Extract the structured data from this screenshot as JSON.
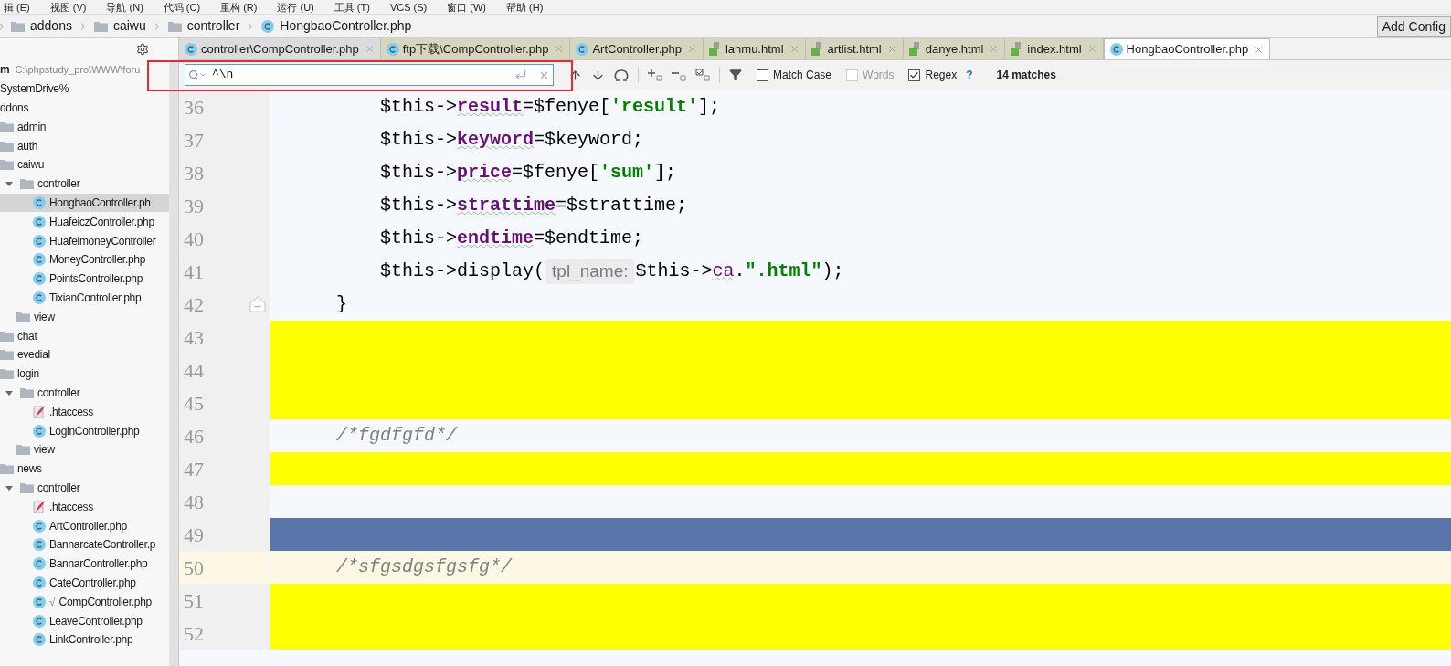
{
  "menu": [
    "辑 (E)",
    "视图 (V)",
    "导航 (N)",
    "代码 (C)",
    "重构 (R)",
    "运行 (U)",
    "工具 (T)",
    "VCS (S)",
    "窗口 (W)",
    "帮助 (H)"
  ],
  "breadcrumb": [
    {
      "label": "addons",
      "kind": "folder"
    },
    {
      "label": "caiwu",
      "kind": "folder"
    },
    {
      "label": "controller",
      "kind": "folder"
    },
    {
      "label": "HongbaoController.php",
      "kind": "php"
    }
  ],
  "run_config_button": "Add Config",
  "tree": [
    {
      "label": "m",
      "path": "C:\\phpstudy_pro\\WWW\\foru",
      "kind": "root",
      "selected": false
    },
    {
      "label": "SystemDrive%",
      "kind": "drive",
      "selected": false
    },
    {
      "label": "ddons",
      "kind": "folder",
      "selected": false,
      "children": [
        {
          "label": "admin",
          "kind": "folder",
          "selected": false
        },
        {
          "label": "auth",
          "kind": "folder",
          "selected": false
        },
        {
          "label": "caiwu",
          "kind": "folder",
          "selected": false,
          "children": [
            {
              "label": "controller",
              "kind": "folder",
              "expanded": true,
              "selected": false,
              "children": [
                {
                  "label": "HongbaoController.ph",
                  "kind": "php",
                  "selected": true
                },
                {
                  "label": "HuafeiczController.php",
                  "kind": "php",
                  "selected": false
                },
                {
                  "label": "HuafeimoneyController",
                  "kind": "php",
                  "selected": false
                },
                {
                  "label": "MoneyController.php",
                  "kind": "php",
                  "selected": false
                },
                {
                  "label": "PointsController.php",
                  "kind": "php",
                  "selected": false
                },
                {
                  "label": "TixianController.php",
                  "kind": "php",
                  "selected": false
                }
              ]
            },
            {
              "label": "view",
              "kind": "folder",
              "selected": false
            }
          ]
        },
        {
          "label": "chat",
          "kind": "folder",
          "selected": false
        },
        {
          "label": "evedial",
          "kind": "folder",
          "selected": false
        },
        {
          "label": "login",
          "kind": "folder",
          "selected": false,
          "children": [
            {
              "label": "controller",
              "kind": "folder",
              "expanded": true,
              "selected": false,
              "children": [
                {
                  "label": ".htaccess",
                  "kind": "htaccess",
                  "selected": false
                },
                {
                  "label": "LoginController.php",
                  "kind": "php",
                  "selected": false
                }
              ]
            },
            {
              "label": "view",
              "kind": "folder",
              "selected": false
            }
          ]
        },
        {
          "label": "news",
          "kind": "folder",
          "selected": false,
          "children": [
            {
              "label": "controller",
              "kind": "folder",
              "expanded": true,
              "selected": false,
              "children": [
                {
                  "label": ".htaccess",
                  "kind": "htaccess",
                  "selected": false
                },
                {
                  "label": "ArtController.php",
                  "kind": "php",
                  "selected": false
                },
                {
                  "label": "BannarcateController.p",
                  "kind": "php",
                  "selected": false
                },
                {
                  "label": "BannarController.php",
                  "kind": "php",
                  "selected": false
                },
                {
                  "label": "CateController.php",
                  "kind": "php",
                  "selected": false
                },
                {
                  "label": "CompController.php",
                  "prefix": "√",
                  "kind": "php",
                  "selected": false
                },
                {
                  "label": "LeaveController.php",
                  "kind": "php",
                  "selected": false
                },
                {
                  "label": "LinkController.php",
                  "kind": "php",
                  "selected": false
                }
              ]
            }
          ]
        }
      ]
    }
  ],
  "tabs": [
    {
      "label": "controller\\CompController.php",
      "kind": "php",
      "color": "#dcdcdc",
      "selected": false
    },
    {
      "label": "ftp下载\\CompController.php",
      "kind": "php",
      "color": "#d6d5bd",
      "selected": false
    },
    {
      "label": "ArtController.php",
      "kind": "php",
      "color": "#d6d5bd",
      "selected": false
    },
    {
      "label": "lanmu.html",
      "kind": "html",
      "color": "#d6d5bd",
      "selected": false
    },
    {
      "label": "artlist.html",
      "kind": "html",
      "color": "#d6d5bd",
      "selected": false
    },
    {
      "label": "danye.html",
      "kind": "html",
      "color": "#d6d5bd",
      "selected": false
    },
    {
      "label": "index.html",
      "kind": "html",
      "color": "#d6d5bd",
      "selected": false
    },
    {
      "label": "HongbaoController.php",
      "kind": "php",
      "color": "#ffffff",
      "selected": true
    }
  ],
  "find": {
    "value": "^\\n",
    "options": [
      {
        "label": "Match Case",
        "checked": false,
        "disabled": false
      },
      {
        "label": "Words",
        "checked": false,
        "disabled": true
      },
      {
        "label": "Regex",
        "checked": true,
        "disabled": false
      }
    ],
    "help": "?",
    "matches": "14 matches"
  },
  "lines": [
    {
      "number": "36",
      "matched": false,
      "selected": false,
      "caret_line": false,
      "fold": false,
      "tokens": [
        {
          "t": "        $this->",
          "kind": "plain"
        },
        {
          "t": "result",
          "kind": "field"
        },
        {
          "t": "=$fenye[",
          "kind": "plain"
        },
        {
          "t": "'result'",
          "kind": "string"
        },
        {
          "t": "];",
          "kind": "plain"
        }
      ]
    },
    {
      "number": "37",
      "matched": false,
      "selected": false,
      "caret_line": false,
      "fold": false,
      "tokens": [
        {
          "t": "        $this->",
          "kind": "plain"
        },
        {
          "t": "keyword",
          "kind": "field"
        },
        {
          "t": "=$keyword;",
          "kind": "plain"
        }
      ]
    },
    {
      "number": "38",
      "matched": false,
      "selected": false,
      "caret_line": false,
      "fold": false,
      "tokens": [
        {
          "t": "        $this->",
          "kind": "plain"
        },
        {
          "t": "price",
          "kind": "field"
        },
        {
          "t": "=$fenye[",
          "kind": "plain"
        },
        {
          "t": "'sum'",
          "kind": "string"
        },
        {
          "t": "];",
          "kind": "plain"
        }
      ]
    },
    {
      "number": "39",
      "matched": false,
      "selected": false,
      "caret_line": false,
      "fold": false,
      "tokens": [
        {
          "t": "        $this->",
          "kind": "plain"
        },
        {
          "t": "strattime",
          "kind": "field"
        },
        {
          "t": "=$strattime;",
          "kind": "plain"
        }
      ]
    },
    {
      "number": "40",
      "matched": false,
      "selected": false,
      "caret_line": false,
      "fold": false,
      "tokens": [
        {
          "t": "        $this->",
          "kind": "plain"
        },
        {
          "t": "endtime",
          "kind": "field"
        },
        {
          "t": "=$endtime;",
          "kind": "plain"
        }
      ]
    },
    {
      "number": "41",
      "matched": false,
      "selected": false,
      "caret_line": false,
      "fold": false,
      "tokens": [
        {
          "t": "        $this->display(",
          "kind": "plain"
        },
        {
          "t": "tpl_name:",
          "kind": "hint"
        },
        {
          "t": "$this->",
          "kind": "plain"
        },
        {
          "t": "ca",
          "kind": "field-plain"
        },
        {
          "t": ".",
          "kind": "plain"
        },
        {
          "t": "\".html\"",
          "kind": "string"
        },
        {
          "t": ");",
          "kind": "plain"
        }
      ]
    },
    {
      "number": "42",
      "matched": false,
      "selected": false,
      "caret_line": false,
      "fold": true,
      "tokens": [
        {
          "t": "    }",
          "kind": "plain"
        }
      ]
    },
    {
      "number": "43",
      "matched": true,
      "selected": false,
      "caret_line": false,
      "fold": false
    },
    {
      "number": "44",
      "matched": true,
      "selected": false,
      "caret_line": false,
      "fold": false
    },
    {
      "number": "45",
      "matched": true,
      "selected": false,
      "caret_line": false,
      "fold": false
    },
    {
      "number": "46",
      "matched": false,
      "selected": false,
      "caret_line": false,
      "fold": false,
      "tokens": [
        {
          "t": "    /*fgdfgfd*/",
          "kind": "comment"
        }
      ]
    },
    {
      "number": "47",
      "matched": true,
      "selected": false,
      "caret_line": false,
      "fold": false
    },
    {
      "number": "48",
      "matched": false,
      "selected": false,
      "caret_line": false,
      "fold": false
    },
    {
      "number": "49",
      "matched": true,
      "selected": true,
      "caret_line": false,
      "fold": false
    },
    {
      "number": "50",
      "matched": false,
      "selected": false,
      "caret_line": true,
      "fold": false,
      "tokens": [
        {
          "t": "    /*sfgsdgsfgsfg*/",
          "kind": "comment"
        }
      ]
    },
    {
      "number": "51",
      "matched": true,
      "selected": false,
      "caret_line": false,
      "fold": false
    },
    {
      "number": "52",
      "matched": true,
      "selected": false,
      "caret_line": false,
      "fold": false
    }
  ]
}
